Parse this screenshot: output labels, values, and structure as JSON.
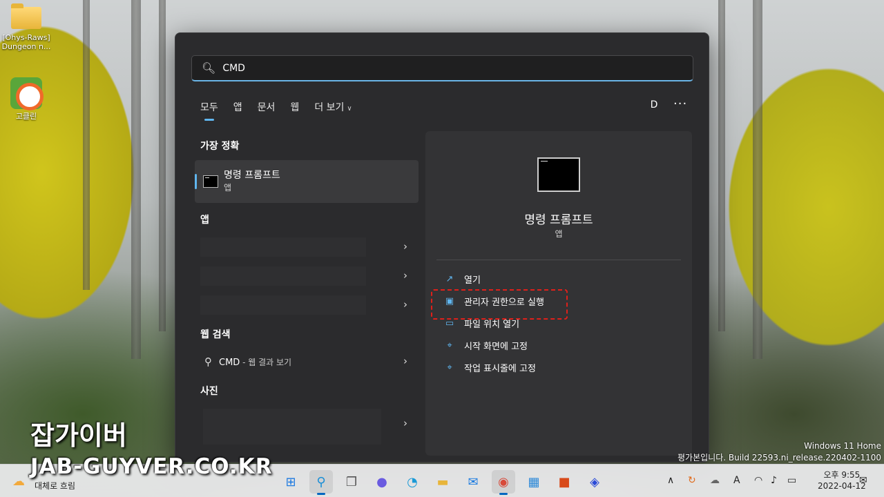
{
  "desktop": {
    "icons": [
      {
        "label": "[Ohys-Raws]\nDungeon n..."
      },
      {
        "label": "고클린"
      }
    ]
  },
  "search": {
    "query": "CMD"
  },
  "tabs": [
    {
      "label": "모두"
    },
    {
      "label": "앱"
    },
    {
      "label": "문서"
    },
    {
      "label": "웹"
    },
    {
      "label": "더 보기"
    }
  ],
  "user_initial": "D",
  "more_label": "···",
  "best_match": {
    "section": "가장 정확",
    "title": "명령 프롬프트",
    "subtitle": "앱"
  },
  "apps_section": "앱",
  "web_section": "웹 검색",
  "web_result": {
    "main": "CMD",
    "suffix": " - 웹 결과 보기"
  },
  "photos_section": "사진",
  "detail": {
    "title": "명령 프롬프트",
    "subtitle": "앱",
    "actions": [
      {
        "label": "열기",
        "icon": "open-icon"
      },
      {
        "label": "관리자 권한으로 실행",
        "icon": "shield-icon"
      },
      {
        "label": "파일 위치 열기",
        "icon": "folder-icon"
      },
      {
        "label": "시작 화면에 고정",
        "icon": "pin-icon"
      },
      {
        "label": "작업 표시줄에 고정",
        "icon": "pin-icon"
      }
    ]
  },
  "watermark": {
    "line1": "잡가이버",
    "line2": "JAB-GUYVER.CO.KR"
  },
  "windows_version": {
    "line1": "Windows 11 Home",
    "line2": "평가본입니다. Build 22593.ni_release.220402-1100"
  },
  "taskbar": {
    "weather": "대체로 흐림",
    "time": "오후 9:55",
    "date": "2022-04-12"
  },
  "colors": {
    "accent": "#60b6ef",
    "highlight": "#e0201a",
    "panel_bg": "#2b2b2d"
  }
}
